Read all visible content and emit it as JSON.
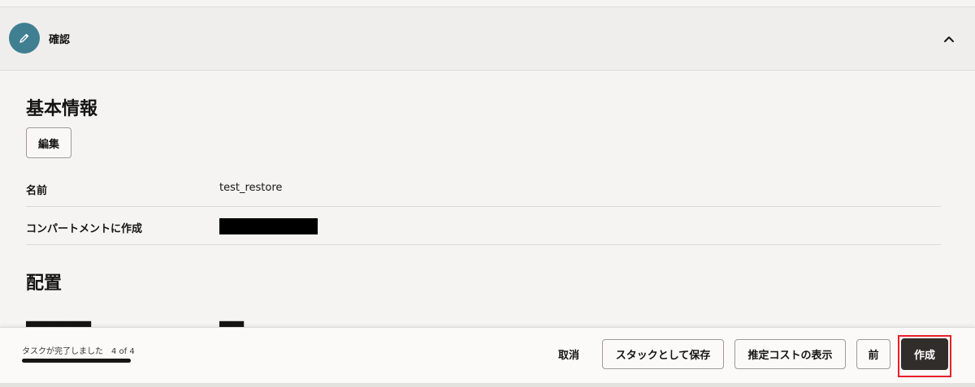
{
  "step": {
    "title": "確認",
    "icon": "pencil-icon",
    "collapse_icon": "chevron-up-icon"
  },
  "basic_info": {
    "heading": "基本情報",
    "edit_label": "編集",
    "rows": [
      {
        "label": "名前",
        "value": "test_restore"
      },
      {
        "label": "コンパートメントに作成",
        "value": ""
      }
    ]
  },
  "placement": {
    "heading": "配置"
  },
  "footer": {
    "progress_text": "タスクが完了しました",
    "progress_count": "4 of 4",
    "progress_fraction": 1.0,
    "cancel_label": "取消",
    "save_stack_label": "スタックとして保存",
    "estimate_cost_label": "推定コストの表示",
    "previous_label": "前",
    "create_label": "作成"
  },
  "colors": {
    "step_icon_bg": "#3f7f91",
    "primary_button": "#312d2a",
    "highlight": "#e8202a"
  }
}
